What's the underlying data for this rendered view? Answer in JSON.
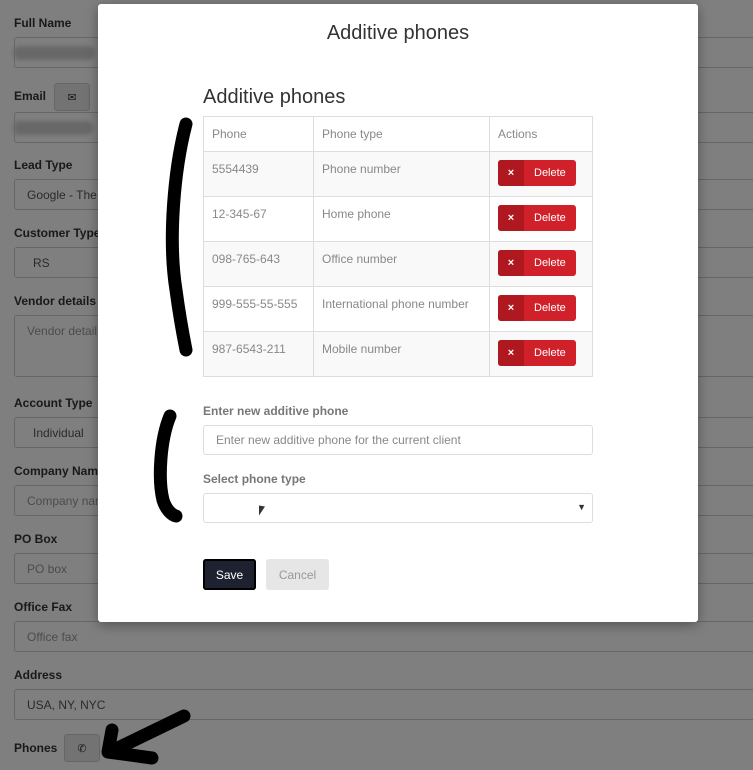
{
  "background_form": {
    "full_name_label": "Full Name",
    "email_label": "Email",
    "email_icon": "envelope-icon",
    "lead_type_label": "Lead Type",
    "lead_type_value": "Google - The",
    "customer_type_label": "Customer Type",
    "customer_type_value": "RS",
    "vendor_details_label": "Vendor details",
    "vendor_details_placeholder": "Vendor detail",
    "account_type_label": "Account Type",
    "account_type_value": "Individual",
    "company_name_label": "Company Nam",
    "company_name_placeholder": "Company nar",
    "po_box_label": "PO Box",
    "po_box_placeholder": "PO box",
    "office_fax_label": "Office Fax",
    "office_fax_placeholder": "Office fax",
    "address_label": "Address",
    "address_value": "USA, NY, NYC",
    "phones_label": "Phones",
    "phones_icon": "phone-icon"
  },
  "modal": {
    "title": "Additive phones",
    "section_title": "Additive phones",
    "table": {
      "headers": [
        "Phone",
        "Phone type",
        "Actions"
      ],
      "rows": [
        {
          "phone": "5554439",
          "type": "Phone number",
          "action": "Delete"
        },
        {
          "phone": "12-345-67",
          "type": "Home phone",
          "action": "Delete"
        },
        {
          "phone": "098-765-643",
          "type": "Office number",
          "action": "Delete"
        },
        {
          "phone": "999-555-55-555",
          "type": "International phone number",
          "action": "Delete"
        },
        {
          "phone": "987-6543-211",
          "type": "Mobile number",
          "action": "Delete"
        }
      ],
      "delete_icon": "×"
    },
    "new_phone_label": "Enter new additive phone",
    "new_phone_placeholder": "Enter new additive phone for the current client",
    "new_phone_value": "",
    "phone_type_label": "Select phone type",
    "phone_type_value": "",
    "save_label": "Save",
    "cancel_label": "Cancel"
  },
  "colors": {
    "delete_button": "#d0202a",
    "save_button": "#1e2230",
    "overlay": "rgba(0,0,0,0.5)"
  }
}
